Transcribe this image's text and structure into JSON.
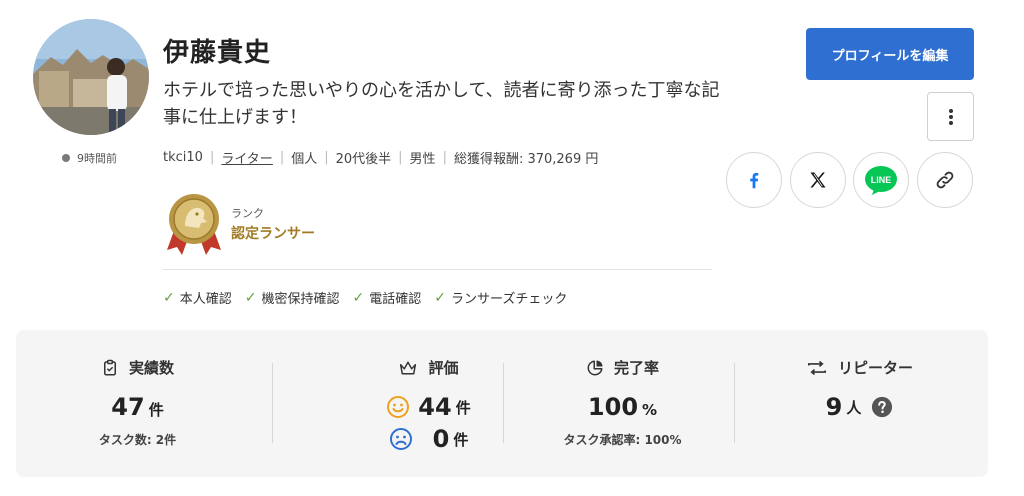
{
  "profile": {
    "name": "伊藤貴史",
    "catchphrase": "ホテルで培った思いやりの心を活かして、読者に寄り添った丁寧な記事に仕上げます！",
    "last_active": "9時間前",
    "meta": {
      "username": "tkci10",
      "role": "ライター",
      "type": "個人",
      "age": "20代後半",
      "gender": "男性",
      "earnings": "総獲得報酬: 370,269 円"
    },
    "rank": {
      "label": "ランク",
      "name": "認定ランサー"
    },
    "verifications": [
      "本人確認",
      "機密保持確認",
      "電話確認",
      "ランサーズチェック"
    ]
  },
  "actions": {
    "edit_label": "プロフィールを編集",
    "line_label": "LINE"
  },
  "stats": {
    "achievements": {
      "label": "実績数",
      "value": "47",
      "unit": "件",
      "sub": "タスク数: 2件"
    },
    "ratings": {
      "label": "評価",
      "good": "44",
      "bad": "0",
      "unit": "件"
    },
    "completion": {
      "label": "完了率",
      "value": "100",
      "unit": "%",
      "sub": "タスク承認率: 100%"
    },
    "repeaters": {
      "label": "リピーター",
      "value": "9",
      "unit": "人"
    }
  },
  "colors": {
    "primary": "#2f6fd1",
    "rank_gold": "#a07b22",
    "check_green": "#63a33b",
    "facebook": "#1877f2",
    "line": "#06c755",
    "smile": "#f0a020",
    "sad": "#2f6fd1"
  },
  "icons": [
    "clipboard-check-icon",
    "crown-icon",
    "pie-chart-icon",
    "repeat-icon",
    "smile-icon",
    "sad-icon",
    "question-icon",
    "kebab-icon",
    "facebook-icon",
    "x-icon",
    "line-icon",
    "link-icon",
    "check-icon",
    "rank-medal-icon"
  ]
}
